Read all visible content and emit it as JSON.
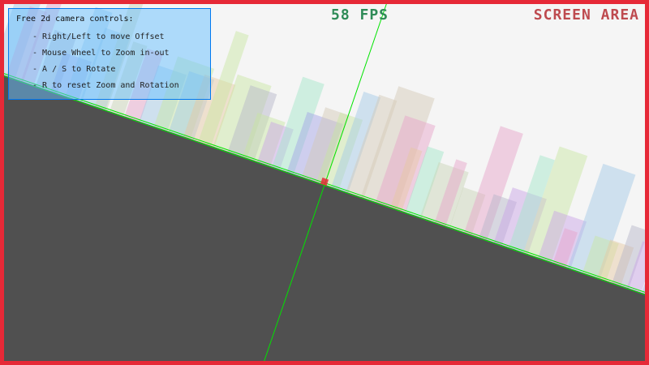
{
  "hud": {
    "fps": "58 FPS",
    "screen_area": "SCREEN AREA"
  },
  "controls": {
    "title": "Free 2d camera controls:",
    "lines": [
      "- Right/Left to move Offset",
      "- Mouse Wheel to Zoom in-out",
      "- A / S to Rotate",
      "- R to reset Zoom and Rotation"
    ]
  },
  "colors": {
    "background": "#f5f5f5",
    "ground": "#505050",
    "frame": "#e62937",
    "axis": "#00e400",
    "player": "#e62937",
    "panel_fill": "#66bfff",
    "panel_border": "#0079f1",
    "fps_text": "#2e8b57",
    "screen_area_text": "#be4a4f"
  }
}
